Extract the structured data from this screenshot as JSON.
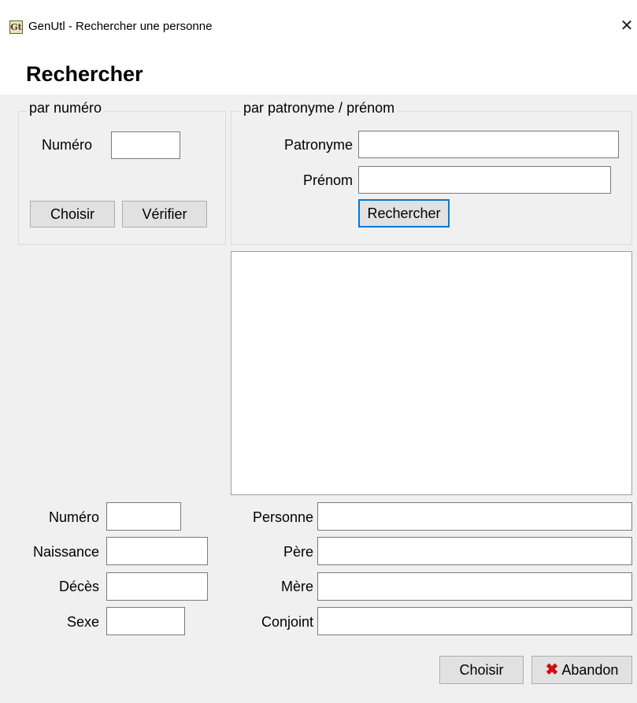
{
  "window": {
    "title": "GenUtl - Rechercher une personne",
    "app_icon": "Gt",
    "close_glyph": "✕"
  },
  "heading": "Rechercher",
  "by_number": {
    "legend": "par numéro",
    "number_label": "Numéro",
    "number_value": "",
    "choose_label": "Choisir",
    "verify_label": "Vérifier"
  },
  "by_name": {
    "legend": "par patronyme / prénom",
    "surname_label": "Patronyme",
    "surname_value": "",
    "firstname_label": "Prénom",
    "firstname_value": "",
    "search_label": "Rechercher"
  },
  "results": {
    "items": []
  },
  "details": {
    "number_label": "Numéro",
    "birth_label": "Naissance",
    "death_label": "Décès",
    "sex_label": "Sexe",
    "person_label": "Personne",
    "father_label": "Père",
    "mother_label": "Mère",
    "spouse_label": "Conjoint",
    "number_value": "",
    "birth_value": "",
    "death_value": "",
    "sex_value": "",
    "person_value": "",
    "father_value": "",
    "mother_value": "",
    "spouse_value": ""
  },
  "footer": {
    "choose_label": "Choisir",
    "abandon_label": "Abandon",
    "abandon_icon": "✖"
  },
  "colors": {
    "background": "#f0f0f0",
    "focus_border": "#0078d7",
    "abandon_icon": "#d01010"
  }
}
